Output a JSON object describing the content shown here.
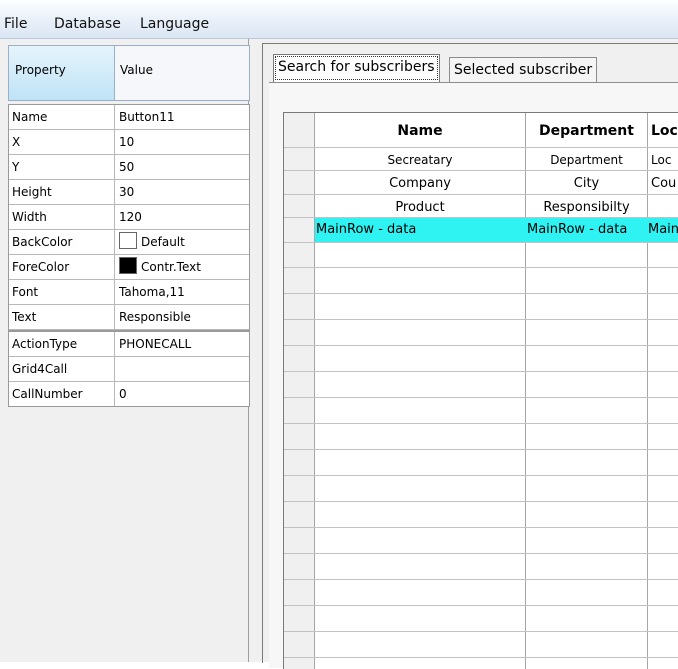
{
  "menu": {
    "file": "File",
    "database": "Database",
    "language": "Language"
  },
  "properties": {
    "header": {
      "property": "Property",
      "value": "Value"
    },
    "rows": [
      {
        "key": "Name",
        "value": "Button11"
      },
      {
        "key": "X",
        "value": "10"
      },
      {
        "key": "Y",
        "value": "50"
      },
      {
        "key": "Height",
        "value": "30"
      },
      {
        "key": "Width",
        "value": "120"
      },
      {
        "key": "BackColor",
        "value": "Default"
      },
      {
        "key": "ForeColor",
        "value": "Contr.Text"
      },
      {
        "key": "Font",
        "value": "Tahoma,11"
      },
      {
        "key": "Text",
        "value": "Responsible"
      },
      {
        "key": "ActionType",
        "value": "PHONECALL"
      },
      {
        "key": "Grid4Call",
        "value": ""
      },
      {
        "key": "CallNumber",
        "value": "0"
      }
    ]
  },
  "tabs": {
    "search": "Search for subscribers",
    "selected": "Selected subscriber"
  },
  "grid": {
    "header": {
      "name": "Name",
      "department": "Department",
      "location": "Loc"
    },
    "template_rows": [
      {
        "c1": "Secreatary",
        "c2": "Department",
        "c3": "Loc"
      },
      {
        "c1": "Company",
        "c2": "City",
        "c3": "Cou"
      },
      {
        "c1": "Product",
        "c2": "Responsibilty",
        "c3": ""
      }
    ],
    "main_row": {
      "c1": "MainRow - data",
      "c2": "MainRow - data",
      "c3": "MainR"
    }
  },
  "colors": {
    "highlight": "#2ff3f3",
    "menu_bg": "#e6eef8"
  }
}
